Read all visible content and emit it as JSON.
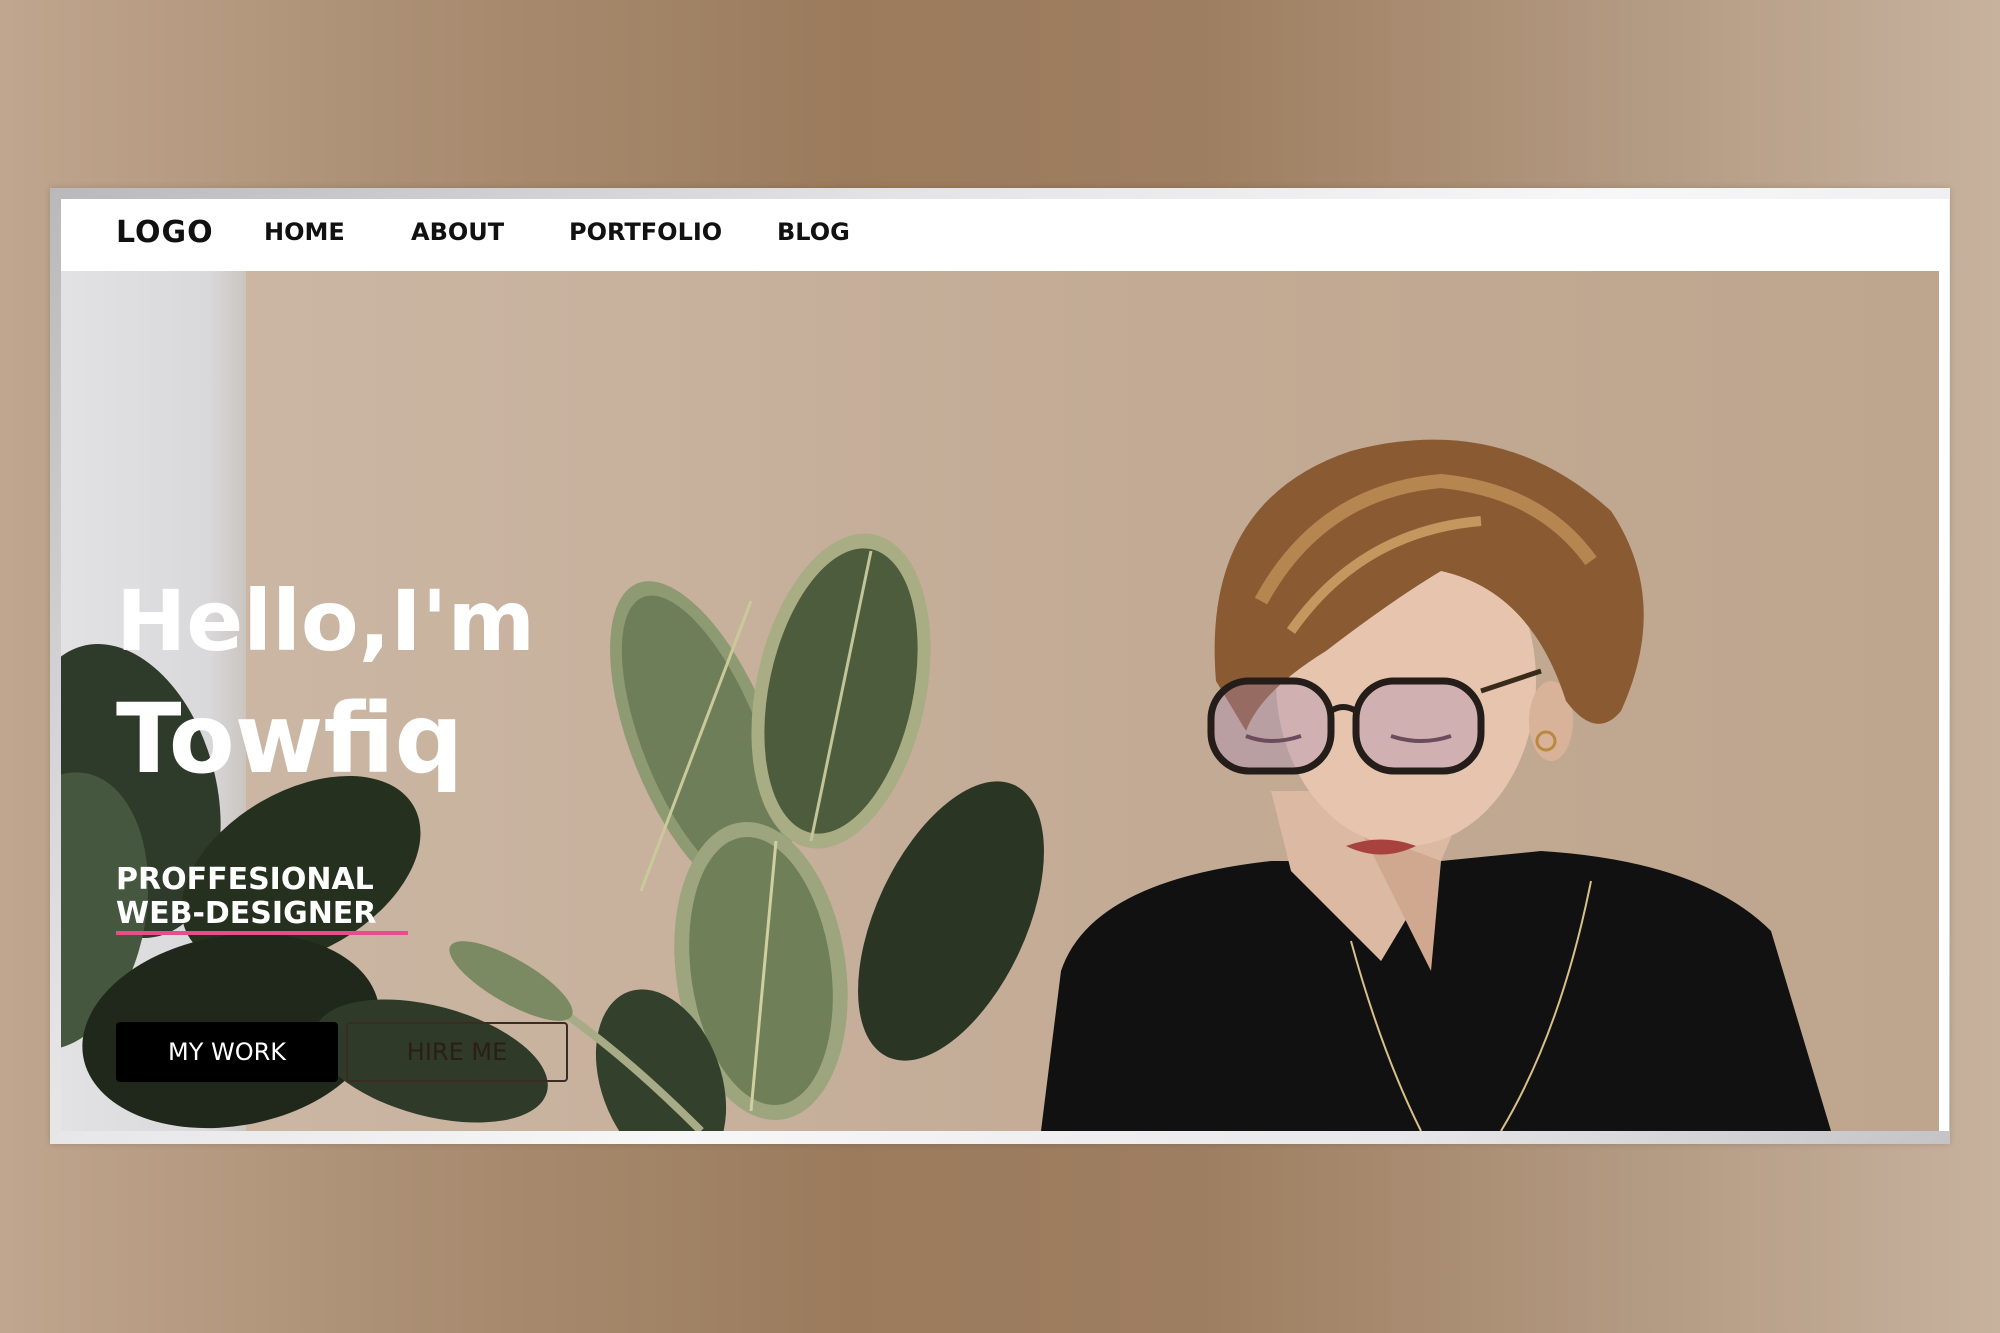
{
  "nav": {
    "logo": "LOGO",
    "links": [
      "HOME",
      "ABOUT",
      "PORTFOLIO",
      "BLOG"
    ]
  },
  "hero": {
    "greeting": "Hello,I'm",
    "name": "Towfiq",
    "tagline_line1": "PROFFESIONAL",
    "tagline_line2": "WEB-DESIGNER",
    "primary_button": "MY WORK",
    "secondary_button": "HIRE ME"
  },
  "colors": {
    "accent_underline": "#e84c8a",
    "primary_button_bg": "#000000",
    "background_tan": "#9b7b5c"
  }
}
